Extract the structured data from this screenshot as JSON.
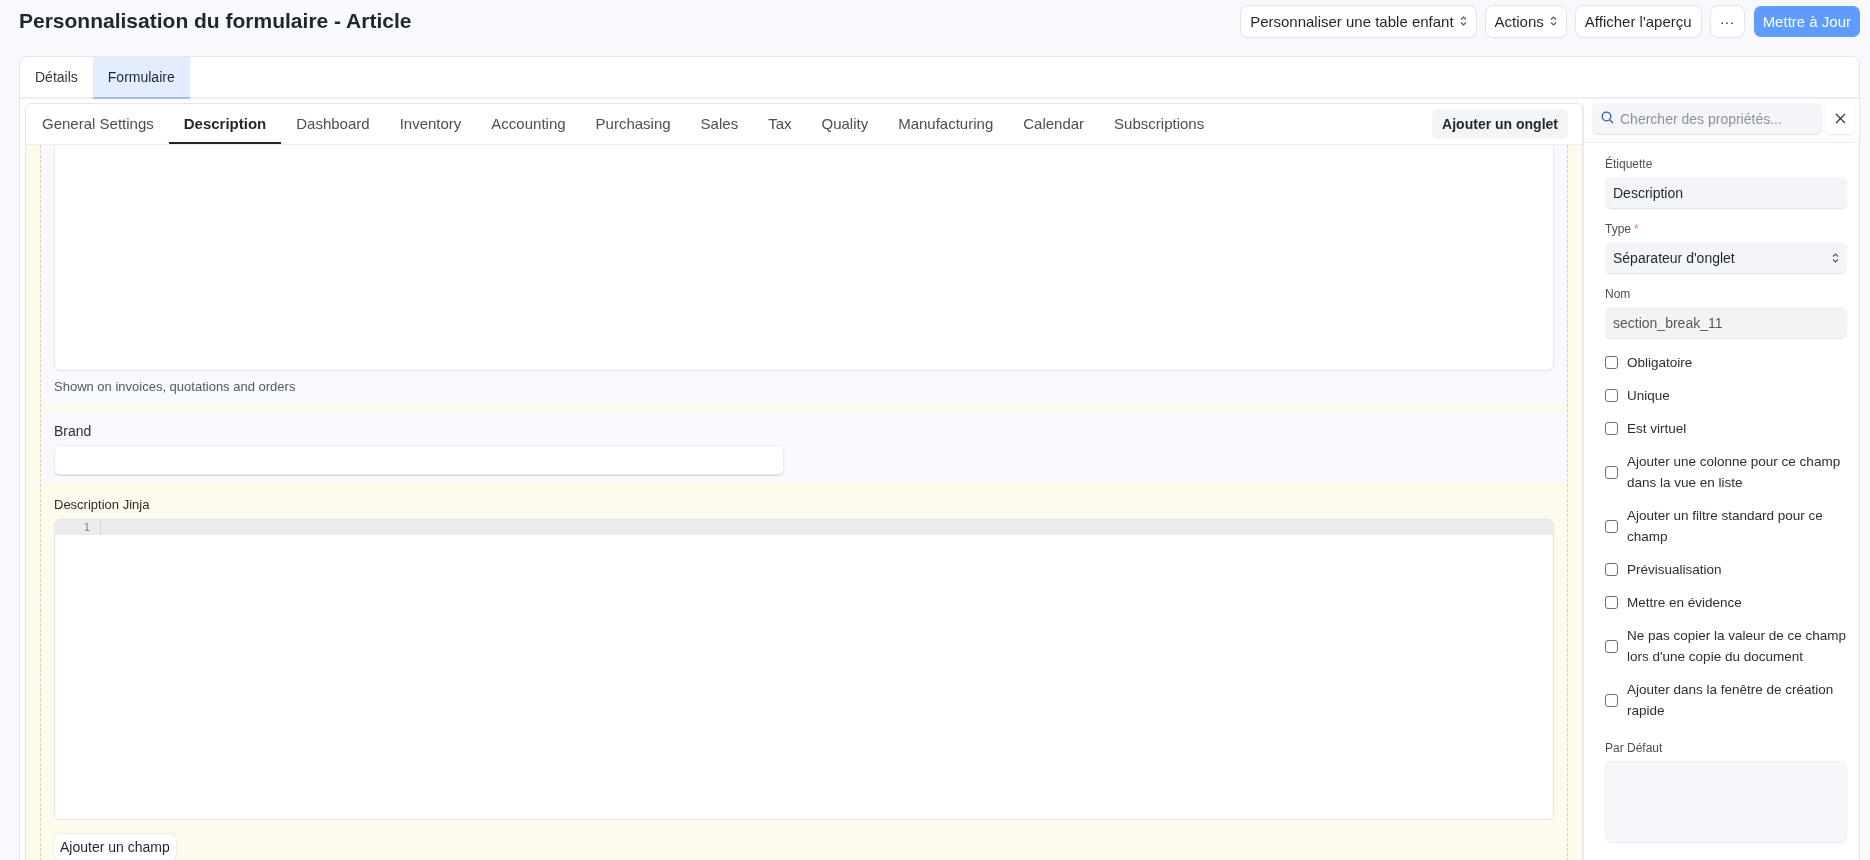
{
  "page": {
    "title": "Personnalisation du formulaire - Article"
  },
  "toolbar": [
    {
      "label": "Personnaliser une table enfant",
      "kind": "dropdown"
    },
    {
      "label": "Actions",
      "kind": "dropdown"
    },
    {
      "label": "Afficher l'aperçu",
      "kind": "plain"
    },
    {
      "label": "···",
      "kind": "plain"
    },
    {
      "label": "Mettre à Jour",
      "kind": "primary"
    }
  ],
  "main_tabs": [
    {
      "label": "Détails",
      "selected": false
    },
    {
      "label": "Formulaire",
      "selected": true
    }
  ],
  "form_tabs": [
    {
      "label": "General Settings",
      "selected": false
    },
    {
      "label": "Description",
      "selected": true
    },
    {
      "label": "Dashboard",
      "selected": false
    },
    {
      "label": "Inventory",
      "selected": false
    },
    {
      "label": "Accounting",
      "selected": false
    },
    {
      "label": "Purchasing",
      "selected": false
    },
    {
      "label": "Sales",
      "selected": false
    },
    {
      "label": "Tax",
      "selected": false
    },
    {
      "label": "Quality",
      "selected": false
    },
    {
      "label": "Manufacturing",
      "selected": false
    },
    {
      "label": "Calendar",
      "selected": false
    },
    {
      "label": "Subscriptions",
      "selected": false
    }
  ],
  "add_tab_button": "Ajouter un onglet",
  "form": {
    "hint": "Shown on invoices, quotations and orders",
    "brand_label": "Brand",
    "jinja_label": "Description Jinja",
    "line_number": "1",
    "add_field_button": "Ajouter un champ"
  },
  "properties": {
    "search_placeholder": "Chercher des propriétés...",
    "label_field": {
      "label": "Étiquette",
      "value": "Description"
    },
    "type_field": {
      "label": "Type",
      "required_mark": "*",
      "value": "Séparateur d'onglet"
    },
    "name_field": {
      "label": "Nom",
      "value": "section_break_11"
    },
    "checkboxes": [
      {
        "label": "Obligatoire",
        "checked": false
      },
      {
        "label": "Unique",
        "checked": false
      },
      {
        "label": "Est virtuel",
        "checked": false
      },
      {
        "label": "Ajouter une colonne pour ce champ dans la vue en liste",
        "checked": false
      },
      {
        "label": "Ajouter un filtre standard pour ce champ",
        "checked": false
      },
      {
        "label": "Prévisualisation",
        "checked": false
      },
      {
        "label": "Mettre en évidence",
        "checked": false
      },
      {
        "label": "Ne pas copier la valeur de ce champ lors d'une copie du document",
        "checked": false
      },
      {
        "label": "Ajouter dans la fenêtre de création rapide",
        "checked": false
      }
    ],
    "default_field": {
      "label": "Par Défaut"
    }
  }
}
